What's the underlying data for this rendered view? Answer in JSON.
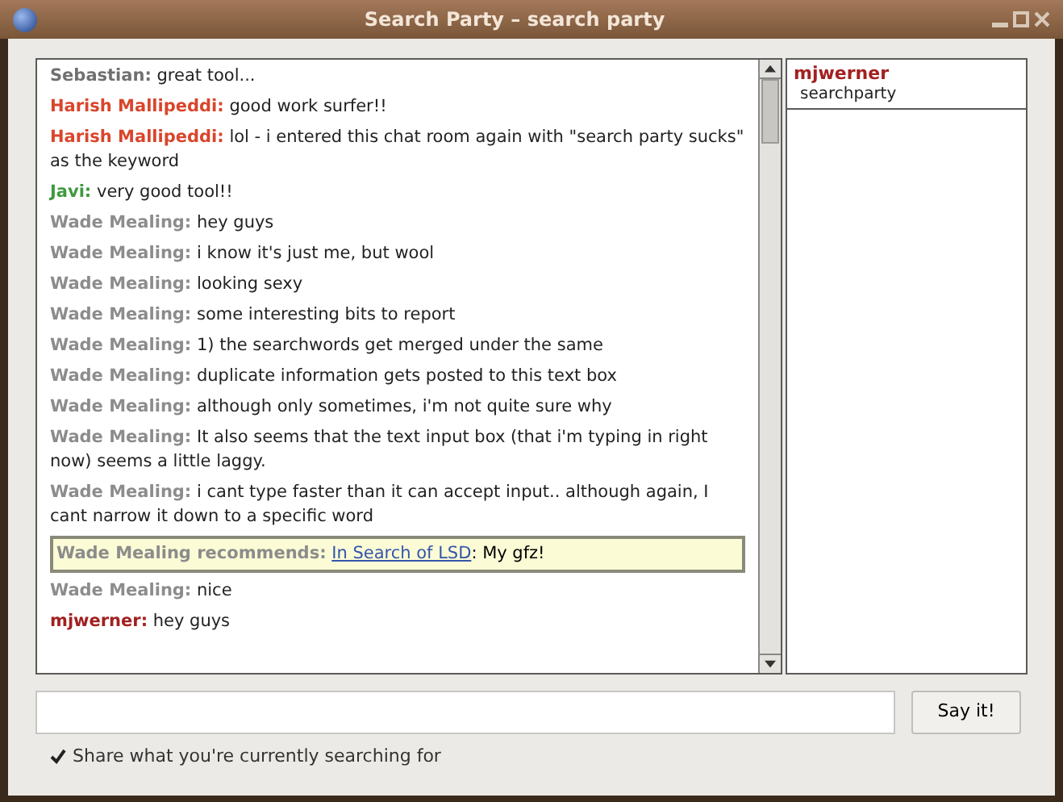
{
  "window": {
    "title": "Search Party – search party"
  },
  "messages": [
    {
      "kind": "message",
      "author": "Sebastian:",
      "color": "#707070",
      "text": "great tool..."
    },
    {
      "kind": "message",
      "author": "Harish Mallipeddi:",
      "color": "#d9452b",
      "text": "good work surfer!!"
    },
    {
      "kind": "message",
      "author": "Harish Mallipeddi:",
      "color": "#d9452b",
      "text": "lol - i entered this chat room again with \"search party sucks\" as the keyword"
    },
    {
      "kind": "message",
      "author": "Javi:",
      "color": "#3e9a3e",
      "text": "very good tool!!"
    },
    {
      "kind": "message",
      "author": "Wade Mealing:",
      "color": "#8c8c8c",
      "text": "hey guys"
    },
    {
      "kind": "message",
      "author": "Wade Mealing:",
      "color": "#8c8c8c",
      "text": "i know it's just me, but wool"
    },
    {
      "kind": "message",
      "author": "Wade Mealing:",
      "color": "#8c8c8c",
      "text": "looking sexy"
    },
    {
      "kind": "message",
      "author": "Wade Mealing:",
      "color": "#8c8c8c",
      "text": "some interesting bits to report"
    },
    {
      "kind": "message",
      "author": "Wade Mealing:",
      "color": "#8c8c8c",
      "text": "1) the searchwords get merged under the same"
    },
    {
      "kind": "message",
      "author": "Wade Mealing:",
      "color": "#8c8c8c",
      "text": "duplicate information gets posted to this text box"
    },
    {
      "kind": "message",
      "author": "Wade Mealing:",
      "color": "#8c8c8c",
      "text": "although only sometimes, i'm not quite sure why"
    },
    {
      "kind": "message",
      "author": "Wade Mealing:",
      "color": "#8c8c8c",
      "text": "It also seems that the text input box (that i'm typing in right now) seems a little laggy."
    },
    {
      "kind": "message",
      "author": "Wade Mealing:",
      "color": "#8c8c8c",
      "text": "i cant type faster than it can accept input.. although again, I cant narrow it down to a specific word"
    },
    {
      "kind": "recommendation",
      "author": "Wade Mealing recommends:",
      "color": "#8c8c8c",
      "link": "In Search of LSD",
      "text": ": My gfz!"
    },
    {
      "kind": "message",
      "author": "Wade Mealing:",
      "color": "#8c8c8c",
      "text": "nice"
    },
    {
      "kind": "message",
      "author": "mjwerner:",
      "color": "#a32020",
      "text": "hey guys"
    }
  ],
  "users": [
    {
      "name": "mjwerner",
      "status": "searchparty"
    }
  ],
  "send_button": "Say it!",
  "share": {
    "label": "Share what you're currently searching for",
    "checked": true
  }
}
